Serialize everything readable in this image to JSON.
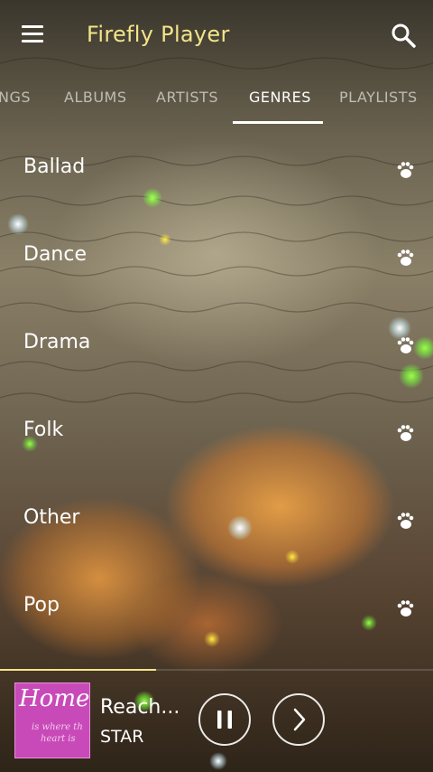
{
  "app": {
    "title": "Firefly Player",
    "accent": "#f3e48a"
  },
  "header": {
    "menu_icon": "hamburger-menu-icon",
    "search_icon": "search-icon"
  },
  "tabs": [
    {
      "label": "NGS"
    },
    {
      "label": "ALBUMS"
    },
    {
      "label": "ARTISTS"
    },
    {
      "label": "GENRES",
      "active": true
    },
    {
      "label": "PLAYLISTS"
    }
  ],
  "genres": [
    {
      "label": "Ballad"
    },
    {
      "label": "Dance"
    },
    {
      "label": "Drama"
    },
    {
      "label": "Folk"
    },
    {
      "label": "Other"
    },
    {
      "label": "Pop"
    }
  ],
  "genre_action_icon": "paw-icon",
  "now_playing": {
    "title": "Reach...",
    "artist": "STAR",
    "progress": 0.36,
    "art": {
      "title": "Home",
      "subtitle_line1": "is where th",
      "subtitle_line2": "heart is"
    }
  },
  "controls": {
    "pause_icon": "pause-icon",
    "next_icon": "chevron-right-icon"
  }
}
